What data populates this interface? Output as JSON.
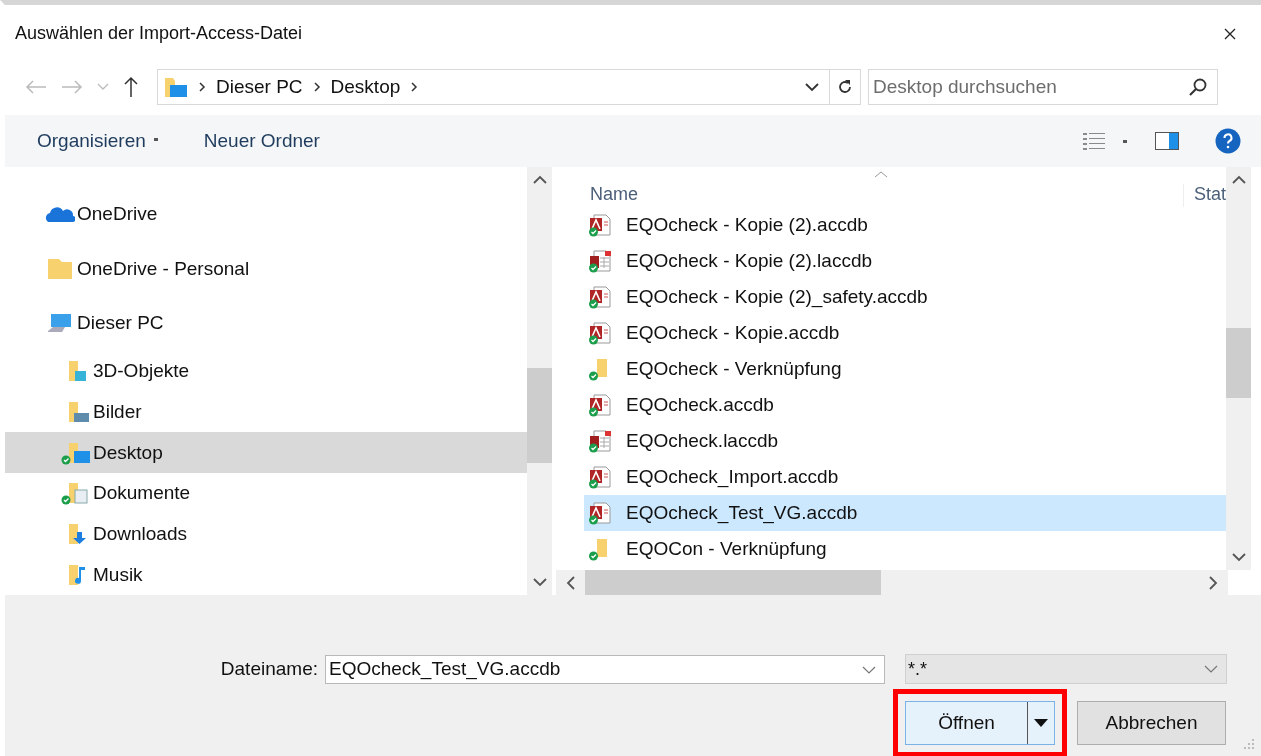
{
  "window": {
    "title": "Auswählen der Import-Access-Datei"
  },
  "address": {
    "path": [
      "Dieser PC",
      "Desktop"
    ]
  },
  "search": {
    "placeholder": "Desktop durchsuchen"
  },
  "toolbar": {
    "items": [
      {
        "label": "Organisieren",
        "menu": true
      },
      {
        "label": "Neuer Ordner",
        "menu": false
      }
    ]
  },
  "nav": {
    "items": [
      {
        "label": "OneDrive",
        "kind": "cloud",
        "synced": false,
        "selected": false
      },
      {
        "label": "OneDrive - Personal",
        "kind": "folder",
        "synced": false,
        "selected": false
      },
      {
        "label": "Dieser PC",
        "kind": "pc",
        "synced": false,
        "selected": false,
        "children": [
          {
            "label": "3D-Objekte",
            "kind": "objects",
            "synced": false,
            "selected": false
          },
          {
            "label": "Bilder",
            "kind": "pictures",
            "synced": false,
            "selected": false
          },
          {
            "label": "Desktop",
            "kind": "desktop",
            "synced": true,
            "selected": true
          },
          {
            "label": "Dokumente",
            "kind": "documents",
            "synced": true,
            "selected": false
          },
          {
            "label": "Downloads",
            "kind": "downloads",
            "synced": false,
            "selected": false
          },
          {
            "label": "Musik",
            "kind": "music",
            "synced": false,
            "selected": false
          }
        ]
      }
    ]
  },
  "files": {
    "columns": [
      "Name",
      "Stat"
    ],
    "rows": [
      {
        "name": "EQOcheck - Kopie (2).accdb",
        "kind": "database",
        "synced": true,
        "selected": false
      },
      {
        "name": "EQOcheck - Kopie (2).laccdb",
        "kind": "lockfile",
        "synced": true,
        "selected": false
      },
      {
        "name": "EQOcheck - Kopie (2)_safety.accdb",
        "kind": "database",
        "synced": true,
        "selected": false
      },
      {
        "name": "EQOcheck - Kopie.accdb",
        "kind": "database",
        "synced": true,
        "selected": false
      },
      {
        "name": "EQOcheck - Verknüpfung",
        "kind": "shortcut",
        "synced": true,
        "selected": false
      },
      {
        "name": "EQOcheck.accdb",
        "kind": "database",
        "synced": true,
        "selected": false
      },
      {
        "name": "EQOcheck.laccdb",
        "kind": "lockfile",
        "synced": true,
        "selected": false
      },
      {
        "name": "EQOcheck_Import.accdb",
        "kind": "database",
        "synced": true,
        "selected": false
      },
      {
        "name": "EQOcheck_Test_VG.accdb",
        "kind": "database",
        "synced": true,
        "selected": true
      },
      {
        "name": "EQOCon - Verknüpfung",
        "kind": "shortcut",
        "synced": true,
        "selected": false
      }
    ]
  },
  "footer": {
    "filename_label": "Dateiname:",
    "filename": "EQOcheck_Test_VG.accdb",
    "filter": "*.*",
    "open_button": {
      "label": "Öffnen",
      "highlighted": true
    },
    "cancel_button": {
      "label": "Abbrechen"
    }
  }
}
